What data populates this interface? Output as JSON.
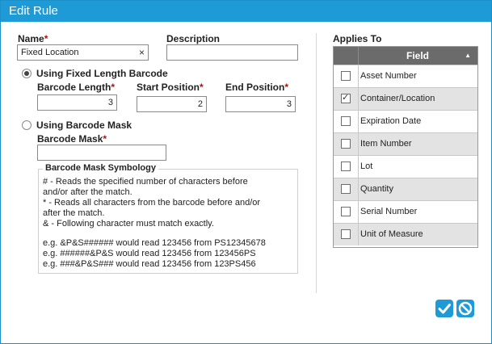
{
  "window": {
    "title": "Edit Rule"
  },
  "form": {
    "name_label": "Name",
    "name_value": "Fixed Location",
    "clear_glyph": "×",
    "description_label": "Description",
    "description_value": "",
    "required_marker": "*",
    "fixed_length_option": "Using Fixed Length Barcode",
    "barcode_length_label": "Barcode Length",
    "barcode_length_value": "3",
    "start_position_label": "Start Position",
    "start_position_value": "2",
    "end_position_label": "End Position",
    "end_position_value": "3",
    "mask_option": "Using Barcode Mask",
    "barcode_mask_label": "Barcode Mask",
    "barcode_mask_value": "",
    "selected_mode": "fixed-length"
  },
  "symbology": {
    "title": "Barcode Mask Symbology",
    "lines": [
      "# - Reads the specified number of characters before",
      "and/or after the match.",
      "* - Reads all characters from the barcode before and/or",
      "after the match.",
      "& - Following character must match exactly.",
      "",
      "e.g. &P&S###### would read 123456 from PS12345678",
      "e.g. ######&P&S would read 123456 from 123456PS",
      "e.g. ###&P&S### would read 123456 from 123PS456"
    ]
  },
  "applies_to": {
    "title": "Applies To",
    "column_header": "Field",
    "sort_icon": "sort-ascending-icon",
    "rows": [
      {
        "label": "Asset Number",
        "checked": false
      },
      {
        "label": "Container/Location",
        "checked": true
      },
      {
        "label": "Expiration Date",
        "checked": false
      },
      {
        "label": "Item Number",
        "checked": false
      },
      {
        "label": "Lot",
        "checked": false
      },
      {
        "label": "Quantity",
        "checked": false
      },
      {
        "label": "Serial Number",
        "checked": false
      },
      {
        "label": "Unit of Measure",
        "checked": false
      }
    ]
  },
  "actions": {
    "save_icon": "checkmark-icon",
    "cancel_icon": "cancel-icon"
  },
  "colors": {
    "accent": "#1e9ad6",
    "required": "#d10000",
    "grid_header": "#6b6b6b",
    "row_alt": "#e3e3e3"
  }
}
